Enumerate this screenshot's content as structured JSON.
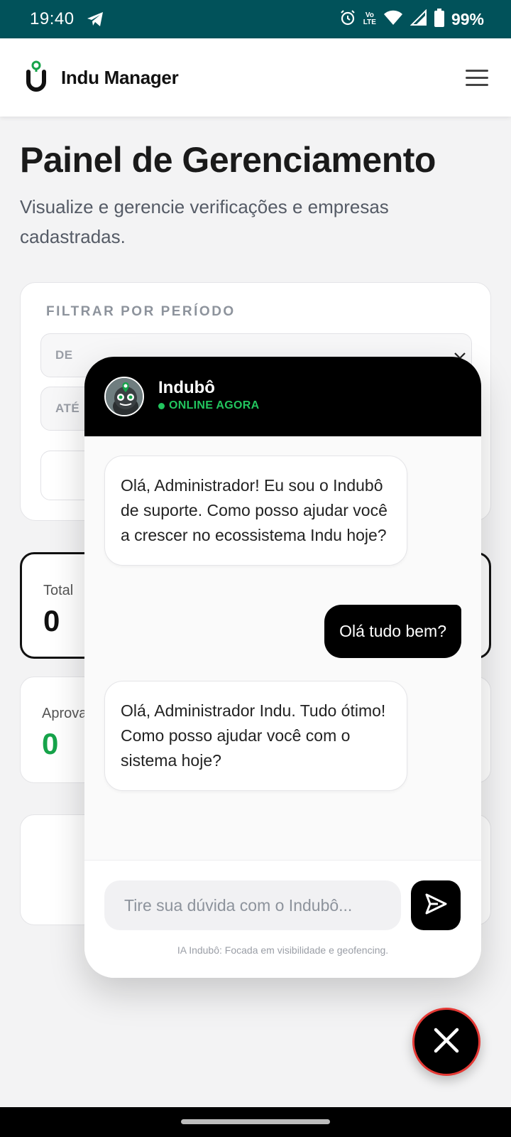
{
  "status_bar": {
    "time": "19:40",
    "volte_top": "Vo",
    "volte_bottom": "LTE",
    "battery": "99%",
    "icons": [
      "telegram-icon",
      "alarm-icon",
      "volte-icon",
      "wifi-icon",
      "signal-icon",
      "battery-icon"
    ]
  },
  "app_header": {
    "brand": "Indu Manager",
    "logo_color": "#16a34a",
    "icons": [
      "indu-logo-icon",
      "hamburger-menu-icon"
    ]
  },
  "page": {
    "title": "Painel de Gerenciamento",
    "subtitle": "Visualize e gerencie verificações e empresas cadastradas."
  },
  "filter": {
    "label": "FILTRAR POR PERÍODO",
    "from_label": "DE",
    "to_label": "ATÉ"
  },
  "stats": {
    "total_label": "Total",
    "total_value": "0",
    "approved_label": "Aprova",
    "approved_value": "0",
    "approved_color": "#16a34a"
  },
  "chat": {
    "name": "Indubô",
    "status": "ONLINE AGORA",
    "status_color": "#22c55e",
    "messages": [
      {
        "from": "bot",
        "text": "Olá, Administrador! Eu sou o Indubô de suporte. Como posso ajudar você a crescer no ecossistema Indu hoje?"
      },
      {
        "from": "user",
        "text": "Olá tudo bem?"
      },
      {
        "from": "bot",
        "text": "Olá, Administrador Indu. Tudo ótimo! Como posso ajudar você com o sistema hoje?"
      }
    ],
    "input_placeholder": "Tire sua dúvida com o Indubô...",
    "footer_note": "IA Indubô: Focada em visibilidade e geofencing."
  },
  "close_button_border": "#e53935"
}
